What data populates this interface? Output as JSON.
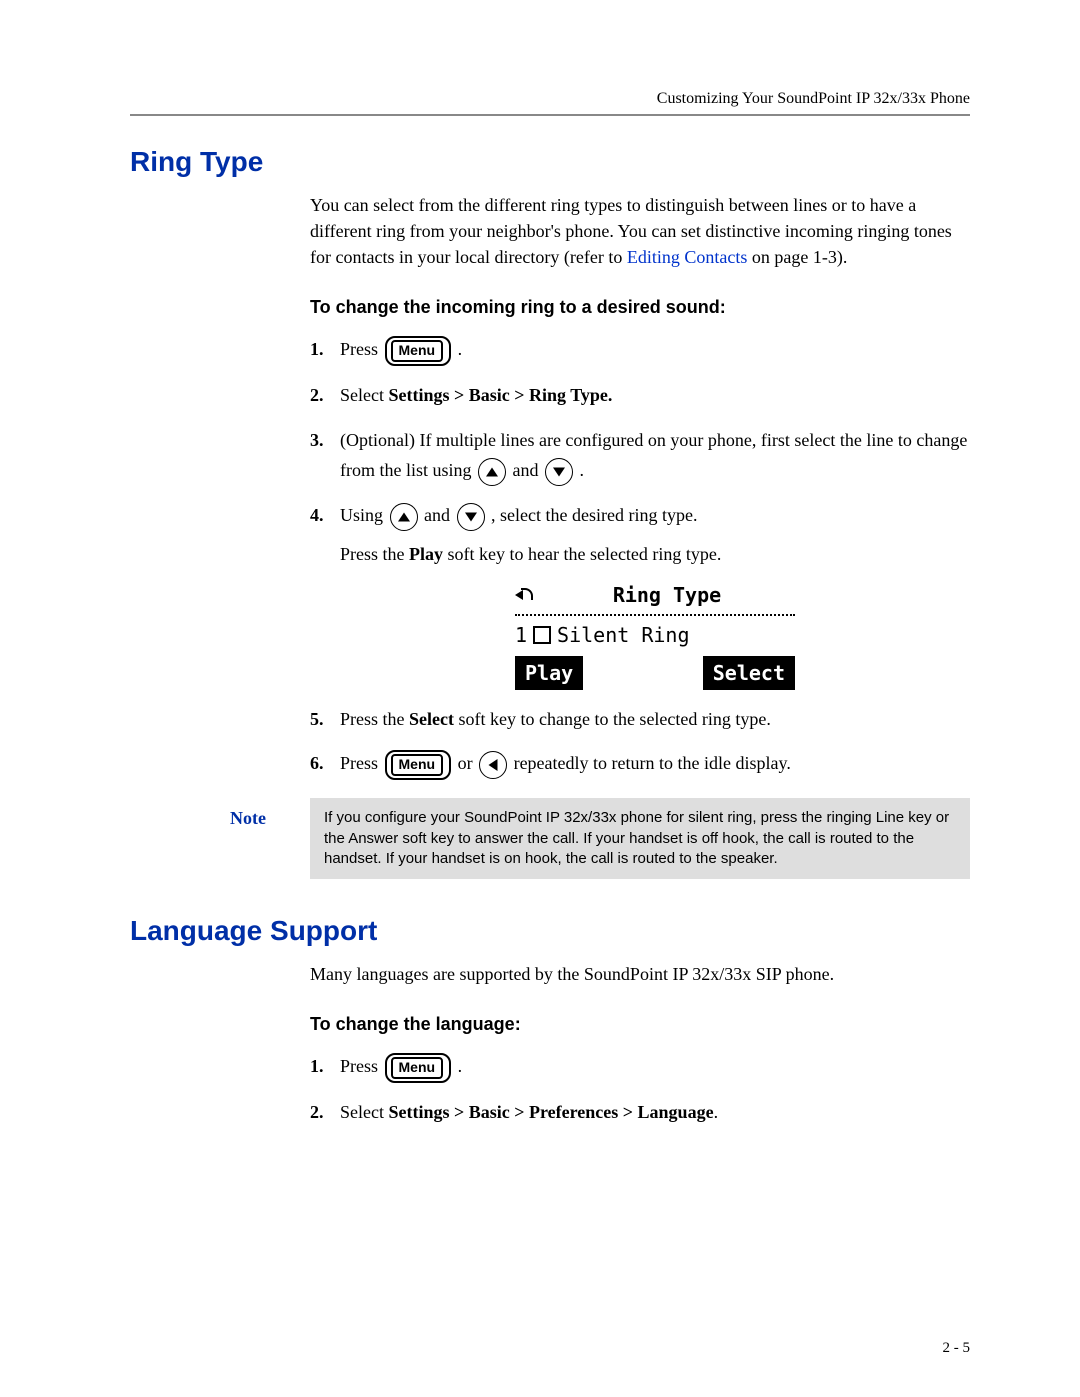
{
  "header": {
    "running_head": "Customizing Your SoundPoint IP 32x/33x Phone"
  },
  "section1": {
    "heading": "Ring Type",
    "intro_pre": "You can select from the different ring types to distinguish between lines or to have a different ring from your neighbor's phone. You can set distinctive incoming ringing tones for contacts in your local directory (refer to ",
    "intro_link": "Editing Contacts",
    "intro_post": " on page 1-3).",
    "subhead": "To change the incoming ring to a desired sound:",
    "menu_label": "Menu",
    "step1_pre": "Press ",
    "step1_post": " .",
    "step2_pre": "Select ",
    "step2_bold": "Settings > Basic > Ring Type.",
    "step3_a": "(Optional) If multiple lines are configured on your phone, first select the line to change from the list using ",
    "step3_and": " and ",
    "step3_end": " .",
    "step4_a": "Using ",
    "step4_and": " and ",
    "step4_b": " , select the desired ring type.",
    "step4_c_pre": "Press the ",
    "step4_c_bold": "Play",
    "step4_c_post": " soft key to hear the selected ring type.",
    "lcd": {
      "title": "Ring Type",
      "row_num": "1",
      "row_text": "Silent Ring",
      "sk_left": "Play",
      "sk_right": "Select"
    },
    "step5_pre": "Press the ",
    "step5_bold": "Select",
    "step5_post": " soft key to change to the selected ring type.",
    "step6_pre": "Press ",
    "step6_or": " or ",
    "step6_post": " repeatedly to return to the idle display.",
    "note_label": "Note",
    "note_text": "If you configure your SoundPoint IP 32x/33x phone for silent ring, press the ringing Line key or the Answer soft key to answer the call. If your handset is off hook, the call is routed to the handset. If your handset is on hook, the call is routed to the speaker."
  },
  "section2": {
    "heading": "Language Support",
    "intro": "Many languages are supported by the SoundPoint IP 32x/33x SIP phone.",
    "subhead": "To change the language:",
    "step1_pre": "Press ",
    "step1_post": " .",
    "step2_pre": "Select ",
    "step2_bold": "Settings > Basic > Preferences > Language",
    "step2_post": "."
  },
  "page_number": "2 - 5"
}
